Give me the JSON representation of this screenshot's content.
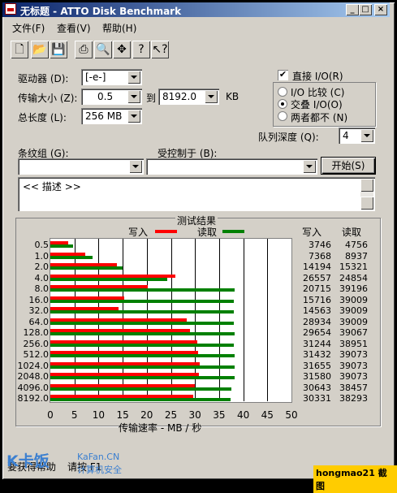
{
  "window": {
    "title": "无标题 - ATTO Disk Benchmark",
    "controls": [
      "_",
      "□",
      "×"
    ]
  },
  "menubar": [
    "文件(F)",
    "查看(V)",
    "帮助(H)"
  ],
  "toolbar": {
    "icons": [
      "new-file-icon",
      "open-folder-icon",
      "save-icon",
      "print-icon",
      "print-preview-icon",
      "move-icon",
      "help-icon",
      "context-help-icon"
    ]
  },
  "settings": {
    "drive_label": "驱动器 (D):",
    "drive_value": "[-e-]",
    "transfer_label": "传输大小 (Z):",
    "transfer_from": "0.5",
    "transfer_to_label": "到",
    "transfer_to": "8192.0",
    "transfer_unit": "KB",
    "total_label": "总长度 (L):",
    "total_value": "256 MB",
    "direct_io_label": "直接 I/O(R)",
    "direct_io_checked": true,
    "io_compare_label": "I/O 比较 (C)",
    "overlapped_io_label": "交叠 I/O(O)",
    "neither_label": "两者都不 (N)",
    "queue_label": "队列深度 (Q):",
    "queue_value": "4",
    "stripe_label": "条纹组 (G):",
    "controlled_by_label": "受控制于 (B):",
    "start_button": "开始(S)",
    "description": "<< 描述 >>"
  },
  "results": {
    "title": "测试结果",
    "write_legend": "写入",
    "read_legend": "读取",
    "write_col": "写入",
    "read_col": "读取",
    "write_color": "#ff0000",
    "read_color": "#008000",
    "xlabel": "传输速率 - MB / 秒"
  },
  "chart_data": {
    "type": "bar",
    "orientation": "horizontal",
    "categories": [
      "0.5",
      "1.0",
      "2.0",
      "4.0",
      "8.0",
      "16.0",
      "32.0",
      "64.0",
      "128.0",
      "256.0",
      "512.0",
      "1024.0",
      "2048.0",
      "4096.0",
      "8192.0"
    ],
    "series": [
      {
        "name": "写入",
        "values": [
          3746,
          7368,
          14194,
          26557,
          20715,
          15716,
          14563,
          28934,
          29654,
          31244,
          31432,
          31655,
          31580,
          30643,
          30331
        ]
      },
      {
        "name": "读取",
        "values": [
          4756,
          8937,
          15321,
          24854,
          39196,
          39009,
          39009,
          39009,
          39067,
          38951,
          39073,
          39073,
          39073,
          38457,
          38293
        ]
      }
    ],
    "xticks": [
      "0",
      "5",
      "10",
      "15",
      "20",
      "25",
      "30",
      "35",
      "40",
      "45",
      "50"
    ],
    "xlim": [
      0,
      50
    ],
    "xlabel": "传输速率 - MB / 秒",
    "grid": true,
    "legend_placement": "top"
  },
  "statusbar": {
    "text1": "要获得帮助",
    "text2": "请按 F1"
  },
  "watermark": {
    "brand": "K卡饭",
    "site": "KaFan.CN",
    "slogan": "计算机安全",
    "credit": "hongmao21 截图"
  }
}
